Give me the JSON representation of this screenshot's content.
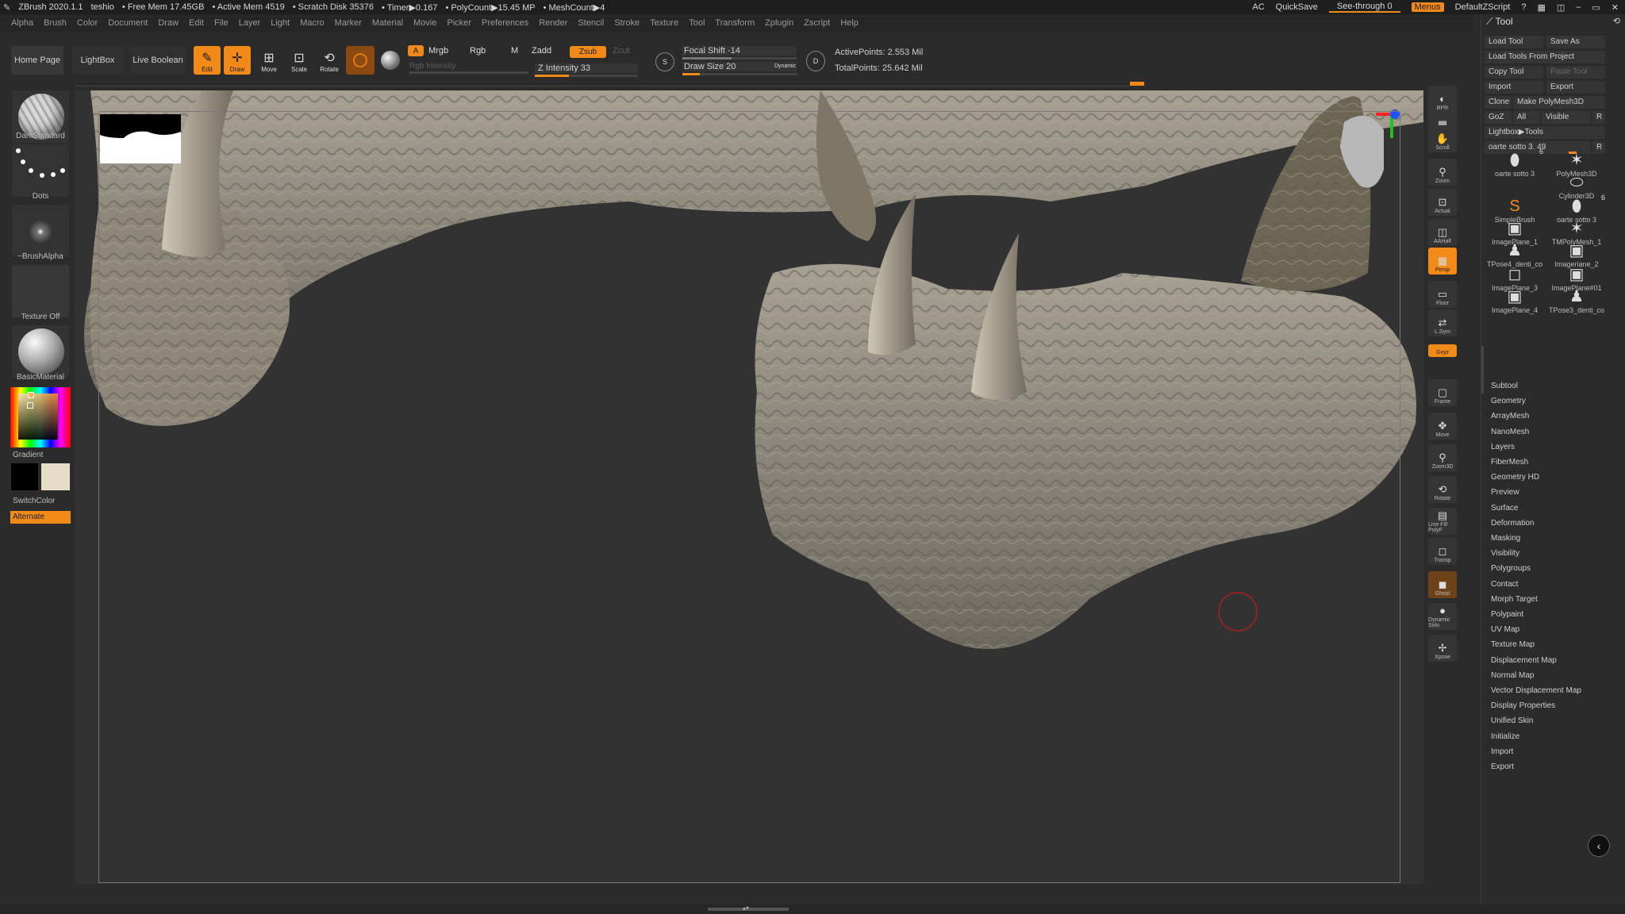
{
  "titlebar": {
    "app": "ZBrush 2020.1.1",
    "user": "teshio",
    "free_mem": "• Free Mem 17.45GB",
    "active_mem": "• Active Mem 4519",
    "scratch": "• Scratch Disk 35376",
    "timer": "• Timer▶0.167",
    "polycount": "• PolyCount▶15.45 MP",
    "meshcount": "• MeshCount▶4",
    "ac": "AC",
    "quicksave": "QuickSave",
    "seethrough": "See-through  0",
    "menus": "Menus",
    "script": "DefaultZScript"
  },
  "menubar": [
    "Alpha",
    "Brush",
    "Color",
    "Document",
    "Draw",
    "Edit",
    "File",
    "Layer",
    "Light",
    "Macro",
    "Marker",
    "Material",
    "Movie",
    "Picker",
    "Preferences",
    "Render",
    "Stencil",
    "Stroke",
    "Texture",
    "Tool",
    "Transform",
    "Zplugin",
    "Zscript",
    "Help"
  ],
  "toolbar": {
    "home": "Home Page",
    "lightbox": "LightBox",
    "live_boolean": "Live Boolean",
    "edit": "Edit",
    "draw": "Draw",
    "move": "Move",
    "scale": "Scale",
    "rotate": "Rotate",
    "a": "A",
    "mrgb": "Mrgb",
    "rgb": "Rgb",
    "m": "M",
    "zadd": "Zadd",
    "zsub": "Zsub",
    "zcut": "Zcut",
    "rgb_intensity": "Rgb Intensity",
    "z_intensity": "Z Intensity 33",
    "z_intensity_value": 33,
    "focal_shift": "Focal Shift -14",
    "draw_size": "Draw Size 20",
    "dynamic": "Dynamic",
    "active_points": "ActivePoints: 2.553 Mil",
    "total_points": "TotalPoints: 25.642 Mil"
  },
  "leftpanel": {
    "brush": "DamStandard",
    "stroke": "Dots",
    "alpha": "~BrushAlpha",
    "texture": "Texture Off",
    "material": "BasicMaterial",
    "gradient": "Gradient",
    "switch_color": "SwitchColor",
    "alternate": "Alternate",
    "primary_color": "#000000",
    "secondary_color": "#e7dcc8"
  },
  "rightshelf": [
    "BPR",
    "SPix 3",
    "Scroll",
    "Zoom",
    "Actual",
    "AAHalf",
    "Persp",
    "Floor",
    "L.Sym",
    "Gxyz",
    "Frame",
    "Move",
    "Zoom3D",
    "Rotate",
    "Line Fill PolyF",
    "Transp",
    "Ghost",
    "Dynamic Solo",
    "Xpose"
  ],
  "toolpanel": {
    "title": "Tool",
    "load_tool": "Load Tool",
    "save_as": "Save As",
    "load_from_project": "Load Tools From Project",
    "copy_tool": "Copy Tool",
    "paste_tool": "Paste Tool",
    "import": "Import",
    "export": "Export",
    "clone": "Clone",
    "make_polymesh": "Make PolyMesh3D",
    "goz": "GoZ",
    "all": "All",
    "visible": "Visible",
    "r": "R",
    "lightbox_tools": "Lightbox▶Tools",
    "current_tool": "oarte sotto 3. 49",
    "tools": [
      {
        "name": "oarte sotto 3",
        "count": "6"
      },
      {
        "name": "PolyMesh3D",
        "count": ""
      },
      {
        "name": "Cylinder3D",
        "count": ""
      },
      {
        "name": "SimpleBrush",
        "count": ""
      },
      {
        "name": "oarte sotto 3",
        "count": "6"
      },
      {
        "name": "ImagePlane_1",
        "count": ""
      },
      {
        "name": "TMPolyMesh_1",
        "count": ""
      },
      {
        "name": "TPose4_denti_co",
        "count": ""
      },
      {
        "name": "Imageriane_2",
        "count": ""
      },
      {
        "name": "ImagePlane_3",
        "count": ""
      },
      {
        "name": "ImagePlane#01",
        "count": ""
      },
      {
        "name": "ImagePlane_4",
        "count": ""
      },
      {
        "name": "TPose3_denti_co",
        "count": ""
      }
    ],
    "menus": [
      "Subtool",
      "Geometry",
      "ArrayMesh",
      "NanoMesh",
      "Layers",
      "FiberMesh",
      "Geometry HD",
      "Preview",
      "Surface",
      "Deformation",
      "Masking",
      "Visibility",
      "Polygroups",
      "Contact",
      "Morph Target",
      "Polypaint",
      "UV Map",
      "Texture Map",
      "Displacement Map",
      "Normal Map",
      "Vector Displacement Map",
      "Display Properties",
      "Unified Skin",
      "Initialize",
      "Import",
      "Export"
    ]
  },
  "colors": {
    "accent": "#f28a1a",
    "mesh": "#8f887a",
    "background": "#323232"
  }
}
